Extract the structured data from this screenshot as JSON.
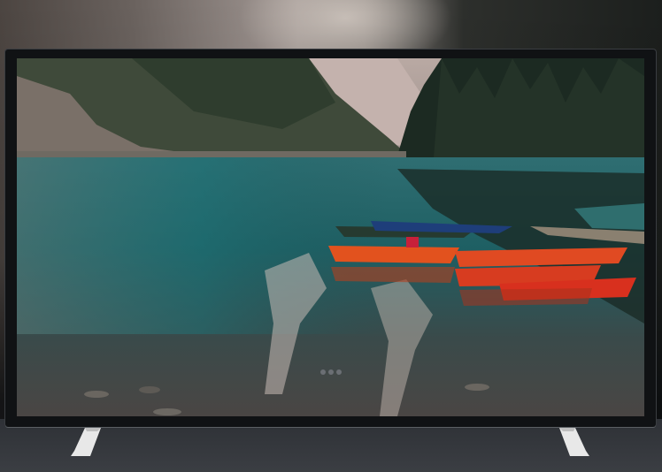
{
  "scene": {
    "subject": "television",
    "icons": [
      "tv-brand-logo",
      "tv-stand-left",
      "tv-stand-right"
    ]
  },
  "colors": {
    "frame": "#101214",
    "water_teal": "#1f6a6e",
    "boat_red": "#e24a1e",
    "stand": "#e8e8e8"
  }
}
